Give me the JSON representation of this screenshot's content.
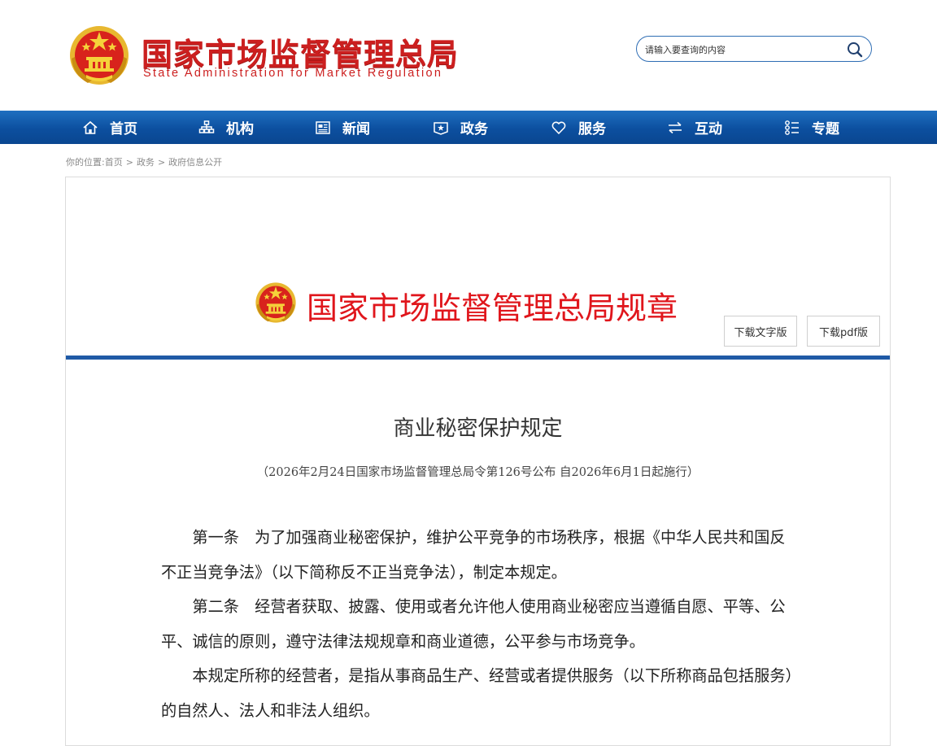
{
  "header": {
    "title": "国家市场监督管理总局",
    "subtitle": "State Administration for Market Regulation",
    "emblem_icon": "national-emblem-icon"
  },
  "search": {
    "placeholder": "请输入要查询的内容",
    "button_icon": "search-icon"
  },
  "nav": {
    "items": [
      {
        "label": "首页",
        "icon": "home-icon"
      },
      {
        "label": "机构",
        "icon": "org-chart-icon"
      },
      {
        "label": "新闻",
        "icon": "newspaper-icon"
      },
      {
        "label": "政务",
        "icon": "government-icon"
      },
      {
        "label": "服务",
        "icon": "heart-icon"
      },
      {
        "label": "互动",
        "icon": "exchange-icon"
      },
      {
        "label": "专题",
        "icon": "topics-icon"
      }
    ]
  },
  "breadcrumb": {
    "prefix": "你的位置:",
    "items": [
      "首页",
      "政务",
      "政府信息公开"
    ],
    "separator": ">"
  },
  "regulation": {
    "banner_title": "国家市场监督管理总局规章",
    "download_text": "下载文字版",
    "download_pdf": "下载pdf版"
  },
  "document": {
    "title": "商业秘密保护规定",
    "meta": "（2026年2月24日国家市场监督管理总局令第126号公布 自2026年6月1日起施行）",
    "paragraphs": [
      "第一条　为了加强商业秘密保护，维护公平竞争的市场秩序，根据《中华人民共和国反不正当竞争法》（以下简称反不正当竞争法），制定本规定。",
      "第二条　经营者获取、披露、使用或者允许他人使用商业秘密应当遵循自愿、平等、公平、诚信的原则，遵守法律法规规章和商业道德，公平参与市场竞争。",
      "本规定所称的经营者，是指从事商品生产、经营或者提供服务（以下所称商品包括服务）的自然人、法人和非法人组织。"
    ]
  },
  "colors": {
    "brand_red": "#cc1f1f",
    "nav_blue": "#0c4f9f",
    "rule_blue": "#1f5aa6",
    "banner_red": "#e0161c"
  }
}
